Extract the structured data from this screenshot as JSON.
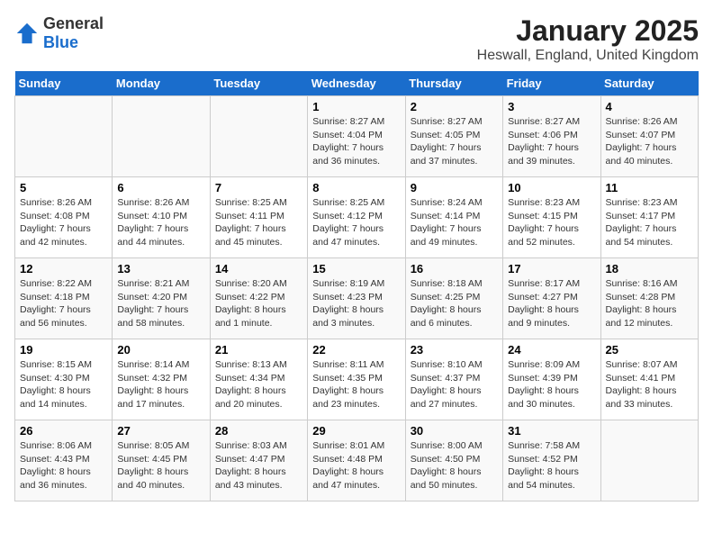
{
  "logo": {
    "general": "General",
    "blue": "Blue"
  },
  "title": "January 2025",
  "subtitle": "Heswall, England, United Kingdom",
  "weekdays": [
    "Sunday",
    "Monday",
    "Tuesday",
    "Wednesday",
    "Thursday",
    "Friday",
    "Saturday"
  ],
  "weeks": [
    [
      {
        "day": "",
        "info": ""
      },
      {
        "day": "",
        "info": ""
      },
      {
        "day": "",
        "info": ""
      },
      {
        "day": "1",
        "info": "Sunrise: 8:27 AM\nSunset: 4:04 PM\nDaylight: 7 hours\nand 36 minutes."
      },
      {
        "day": "2",
        "info": "Sunrise: 8:27 AM\nSunset: 4:05 PM\nDaylight: 7 hours\nand 37 minutes."
      },
      {
        "day": "3",
        "info": "Sunrise: 8:27 AM\nSunset: 4:06 PM\nDaylight: 7 hours\nand 39 minutes."
      },
      {
        "day": "4",
        "info": "Sunrise: 8:26 AM\nSunset: 4:07 PM\nDaylight: 7 hours\nand 40 minutes."
      }
    ],
    [
      {
        "day": "5",
        "info": "Sunrise: 8:26 AM\nSunset: 4:08 PM\nDaylight: 7 hours\nand 42 minutes."
      },
      {
        "day": "6",
        "info": "Sunrise: 8:26 AM\nSunset: 4:10 PM\nDaylight: 7 hours\nand 44 minutes."
      },
      {
        "day": "7",
        "info": "Sunrise: 8:25 AM\nSunset: 4:11 PM\nDaylight: 7 hours\nand 45 minutes."
      },
      {
        "day": "8",
        "info": "Sunrise: 8:25 AM\nSunset: 4:12 PM\nDaylight: 7 hours\nand 47 minutes."
      },
      {
        "day": "9",
        "info": "Sunrise: 8:24 AM\nSunset: 4:14 PM\nDaylight: 7 hours\nand 49 minutes."
      },
      {
        "day": "10",
        "info": "Sunrise: 8:23 AM\nSunset: 4:15 PM\nDaylight: 7 hours\nand 52 minutes."
      },
      {
        "day": "11",
        "info": "Sunrise: 8:23 AM\nSunset: 4:17 PM\nDaylight: 7 hours\nand 54 minutes."
      }
    ],
    [
      {
        "day": "12",
        "info": "Sunrise: 8:22 AM\nSunset: 4:18 PM\nDaylight: 7 hours\nand 56 minutes."
      },
      {
        "day": "13",
        "info": "Sunrise: 8:21 AM\nSunset: 4:20 PM\nDaylight: 7 hours\nand 58 minutes."
      },
      {
        "day": "14",
        "info": "Sunrise: 8:20 AM\nSunset: 4:22 PM\nDaylight: 8 hours\nand 1 minute."
      },
      {
        "day": "15",
        "info": "Sunrise: 8:19 AM\nSunset: 4:23 PM\nDaylight: 8 hours\nand 3 minutes."
      },
      {
        "day": "16",
        "info": "Sunrise: 8:18 AM\nSunset: 4:25 PM\nDaylight: 8 hours\nand 6 minutes."
      },
      {
        "day": "17",
        "info": "Sunrise: 8:17 AM\nSunset: 4:27 PM\nDaylight: 8 hours\nand 9 minutes."
      },
      {
        "day": "18",
        "info": "Sunrise: 8:16 AM\nSunset: 4:28 PM\nDaylight: 8 hours\nand 12 minutes."
      }
    ],
    [
      {
        "day": "19",
        "info": "Sunrise: 8:15 AM\nSunset: 4:30 PM\nDaylight: 8 hours\nand 14 minutes."
      },
      {
        "day": "20",
        "info": "Sunrise: 8:14 AM\nSunset: 4:32 PM\nDaylight: 8 hours\nand 17 minutes."
      },
      {
        "day": "21",
        "info": "Sunrise: 8:13 AM\nSunset: 4:34 PM\nDaylight: 8 hours\nand 20 minutes."
      },
      {
        "day": "22",
        "info": "Sunrise: 8:11 AM\nSunset: 4:35 PM\nDaylight: 8 hours\nand 23 minutes."
      },
      {
        "day": "23",
        "info": "Sunrise: 8:10 AM\nSunset: 4:37 PM\nDaylight: 8 hours\nand 27 minutes."
      },
      {
        "day": "24",
        "info": "Sunrise: 8:09 AM\nSunset: 4:39 PM\nDaylight: 8 hours\nand 30 minutes."
      },
      {
        "day": "25",
        "info": "Sunrise: 8:07 AM\nSunset: 4:41 PM\nDaylight: 8 hours\nand 33 minutes."
      }
    ],
    [
      {
        "day": "26",
        "info": "Sunrise: 8:06 AM\nSunset: 4:43 PM\nDaylight: 8 hours\nand 36 minutes."
      },
      {
        "day": "27",
        "info": "Sunrise: 8:05 AM\nSunset: 4:45 PM\nDaylight: 8 hours\nand 40 minutes."
      },
      {
        "day": "28",
        "info": "Sunrise: 8:03 AM\nSunset: 4:47 PM\nDaylight: 8 hours\nand 43 minutes."
      },
      {
        "day": "29",
        "info": "Sunrise: 8:01 AM\nSunset: 4:48 PM\nDaylight: 8 hours\nand 47 minutes."
      },
      {
        "day": "30",
        "info": "Sunrise: 8:00 AM\nSunset: 4:50 PM\nDaylight: 8 hours\nand 50 minutes."
      },
      {
        "day": "31",
        "info": "Sunrise: 7:58 AM\nSunset: 4:52 PM\nDaylight: 8 hours\nand 54 minutes."
      },
      {
        "day": "",
        "info": ""
      }
    ]
  ]
}
